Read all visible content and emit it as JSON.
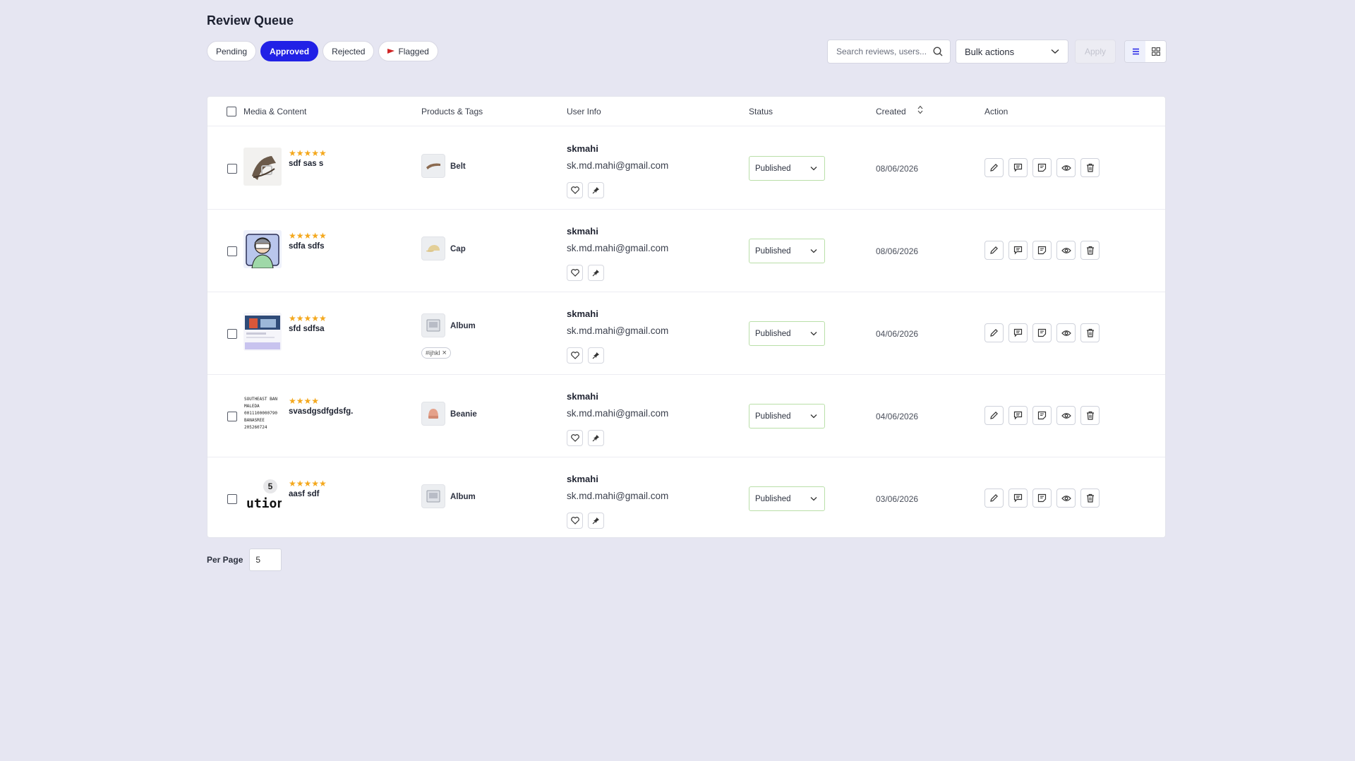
{
  "page": {
    "title": "Review Queue"
  },
  "tabs": [
    {
      "label": "Pending",
      "active": false
    },
    {
      "label": "Approved",
      "active": true
    },
    {
      "label": "Rejected",
      "active": false
    },
    {
      "label": "Flagged",
      "active": false,
      "icon": "flag-icon"
    }
  ],
  "toolbar": {
    "search_placeholder": "Search reviews, users...",
    "bulk_label": "Bulk actions",
    "apply_label": "Apply",
    "view_modes": [
      "list-view-icon",
      "grid-view-icon"
    ],
    "active_view": "list"
  },
  "table": {
    "headers": {
      "media": "Media & Content",
      "products": "Products & Tags",
      "user": "User Info",
      "status": "Status",
      "created": "Created",
      "action": "Action"
    },
    "rows": [
      {
        "rating": 5,
        "stars": "★★★★★",
        "title": "sdf sas s",
        "product": "Belt",
        "tag": "",
        "username": "skmahi",
        "email": "sk.md.mahi@gmail.com",
        "status": "Published",
        "created": "08/06/2026",
        "thumb": "belt-photo"
      },
      {
        "rating": 5,
        "stars": "★★★★★",
        "title": "sdfa sdfs",
        "product": "Cap",
        "tag": "",
        "username": "skmahi",
        "email": "sk.md.mahi@gmail.com",
        "status": "Published",
        "created": "08/06/2026",
        "thumb": "avatar-illustration"
      },
      {
        "rating": 5,
        "stars": "★★★★★",
        "title": "sfd sdfsa",
        "product": "Album",
        "tag": "#ijhkl",
        "username": "skmahi",
        "email": "sk.md.mahi@gmail.com",
        "status": "Published",
        "created": "04/06/2026",
        "thumb": "website-screenshot"
      },
      {
        "rating": 4,
        "stars": "★★★★",
        "title": "svasdgsdfgdsfg.",
        "product": "Beanie",
        "tag": "",
        "username": "skmahi",
        "email": "sk.md.mahi@gmail.com",
        "status": "Published",
        "created": "04/06/2026",
        "thumb": "bank-document"
      },
      {
        "rating": 5,
        "stars": "★★★★★",
        "title": "aasf sdf",
        "product": "Album",
        "tag": "",
        "username": "skmahi",
        "email": "sk.md.mahi@gmail.com",
        "status": "Published",
        "created": "03/06/2026",
        "thumb": "text-image"
      }
    ],
    "doc_lines": [
      "SOUTHEAST BAN",
      "MALEDA",
      "0011100000790",
      "BANASREE",
      "205260724"
    ],
    "badge_number": "5",
    "badge_text": "ution"
  },
  "pagination": {
    "per_page_label": "Per Page",
    "per_page_value": "5"
  },
  "colors": {
    "accent": "#2121e6",
    "star": "#f4a81d",
    "background": "#e6e6f2",
    "status_border": "#b9dfa8"
  }
}
